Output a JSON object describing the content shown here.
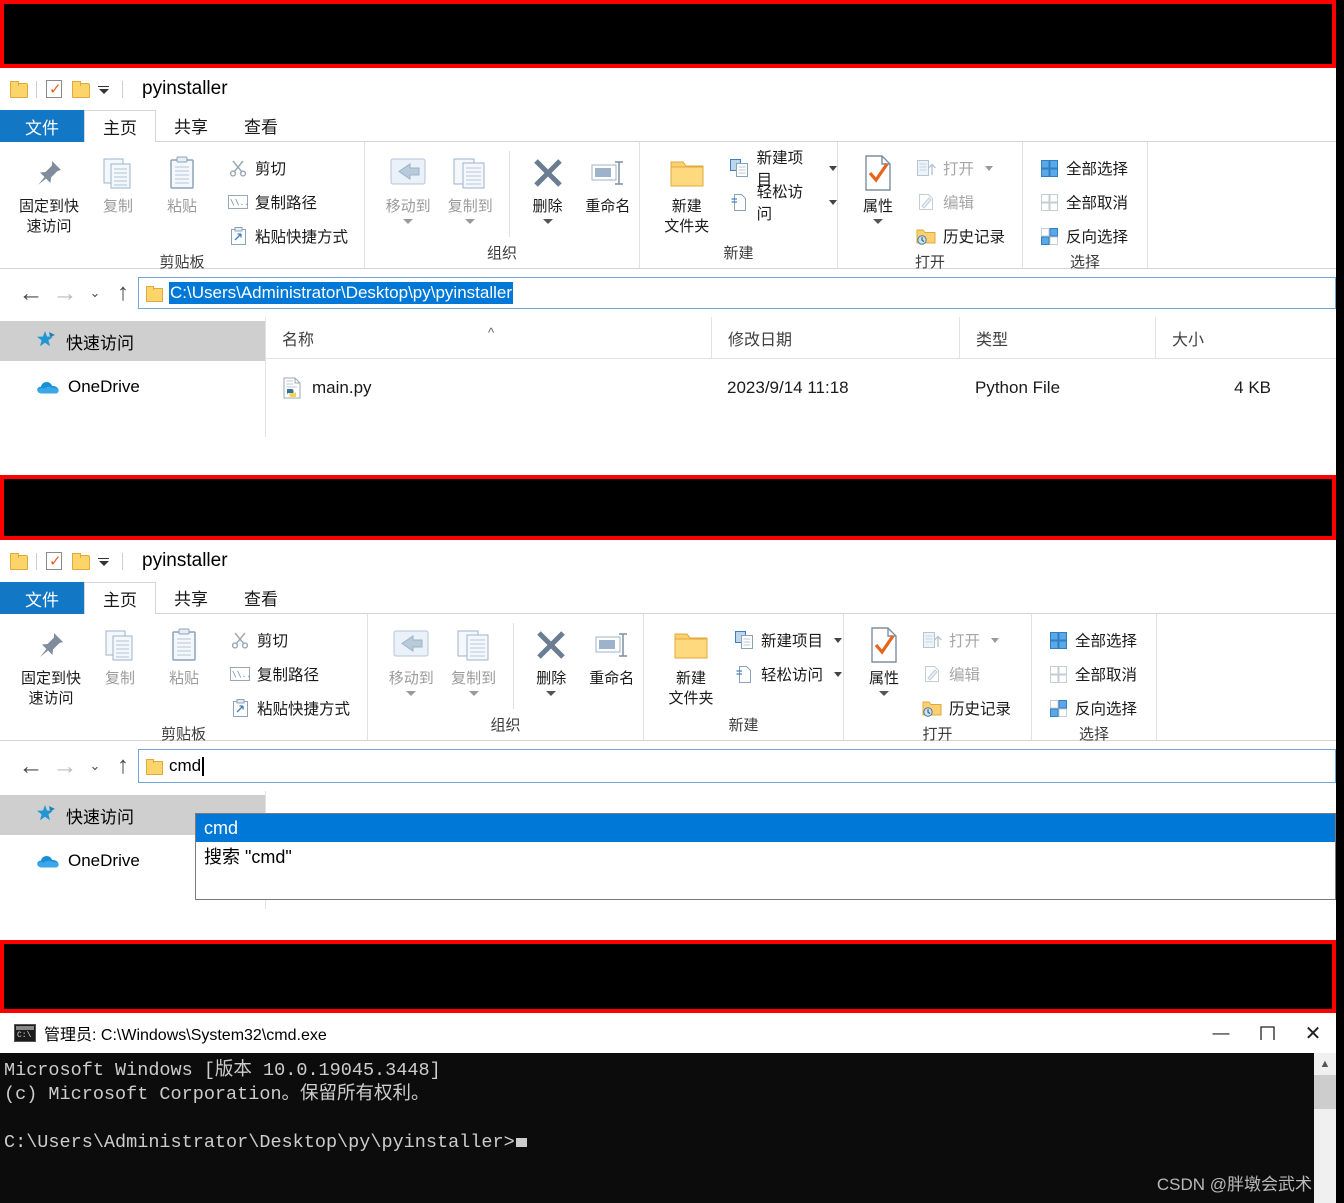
{
  "window": {
    "title": "pyinstaller",
    "quick_access_icons": [
      "folder-icon",
      "properties-check-icon",
      "folder-icon",
      "customize-dropdown-icon"
    ]
  },
  "tabs": [
    {
      "id": "file",
      "label": "文件"
    },
    {
      "id": "home",
      "label": "主页"
    },
    {
      "id": "share",
      "label": "共享"
    },
    {
      "id": "view",
      "label": "查看"
    }
  ],
  "ribbon": {
    "groups": [
      {
        "id": "clipboard",
        "label": "剪贴板",
        "big": [
          {
            "label1": "固定到快",
            "label2": "速访问",
            "icon": "pin-icon"
          },
          {
            "label1": "复制",
            "label2": "",
            "icon": "copy-icon"
          },
          {
            "label1": "粘贴",
            "label2": "",
            "icon": "paste-icon"
          }
        ],
        "small": [
          {
            "label": "剪切",
            "icon": "scissors-icon"
          },
          {
            "label": "复制路径",
            "icon": "copy-path-icon"
          },
          {
            "label": "粘贴快捷方式",
            "icon": "paste-shortcut-icon"
          }
        ]
      },
      {
        "id": "organize",
        "label": "组织",
        "big": [
          {
            "label1": "移动到",
            "label2": "",
            "icon": "move-to-icon",
            "caret": true
          },
          {
            "label1": "复制到",
            "label2": "",
            "icon": "copy-to-icon",
            "caret": true
          },
          {
            "label1": "删除",
            "label2": "",
            "icon": "delete-x-icon",
            "caret": true
          },
          {
            "label1": "重命名",
            "label2": "",
            "icon": "rename-icon"
          }
        ],
        "small": []
      },
      {
        "id": "new",
        "label": "新建",
        "big": [
          {
            "label1": "新建",
            "label2": "文件夹",
            "icon": "new-folder-icon"
          }
        ],
        "small": [
          {
            "label": "新建项目",
            "icon": "new-item-icon",
            "caret": true
          },
          {
            "label": "轻松访问",
            "icon": "easy-access-icon",
            "caret": true
          }
        ]
      },
      {
        "id": "open",
        "label": "打开",
        "big": [
          {
            "label1": "属性",
            "label2": "",
            "icon": "properties-icon",
            "caret": true
          }
        ],
        "small": [
          {
            "label": "打开",
            "icon": "open-icon",
            "caret": true,
            "dim": true
          },
          {
            "label": "编辑",
            "icon": "edit-icon",
            "dim": true
          },
          {
            "label": "历史记录",
            "icon": "history-icon"
          }
        ]
      },
      {
        "id": "select",
        "label": "选择",
        "big": [],
        "small": [
          {
            "label": "全部选择",
            "icon": "select-all-icon"
          },
          {
            "label": "全部取消",
            "icon": "select-none-icon"
          },
          {
            "label": "反向选择",
            "icon": "invert-selection-icon"
          }
        ]
      }
    ]
  },
  "nav": {
    "back_icon": "arrow-left-icon",
    "forward_icon": "arrow-right-icon",
    "recent_icon": "chevron-down-icon",
    "up_icon": "arrow-up-icon"
  },
  "address_top": {
    "value": "C:\\Users\\Administrator\\Desktop\\py\\pyinstaller",
    "selected": true
  },
  "address_bottom": {
    "value": "cmd",
    "suggestions": [
      {
        "label": "cmd",
        "selected": true
      },
      {
        "label": "搜索 \"cmd\"",
        "selected": false
      }
    ]
  },
  "sidebar": {
    "items": [
      {
        "label": "快速访问",
        "icon": "star-pin-icon",
        "selected": true
      },
      {
        "label": "OneDrive",
        "icon": "onedrive-cloud-icon",
        "selected": false
      }
    ]
  },
  "filelist": {
    "columns": [
      "名称",
      "修改日期",
      "类型",
      "大小"
    ],
    "sort_indicator": "^",
    "rows": [
      {
        "name": "main.py",
        "date": "2023/9/14 11:18",
        "type": "Python File",
        "size": "4 KB",
        "icon": "python-file-icon"
      }
    ]
  },
  "cmd": {
    "title": "管理员: C:\\Windows\\System32\\cmd.exe",
    "icon": "console-icon",
    "buttons": {
      "minimize": "—",
      "maximize": "❐",
      "close": "✕"
    },
    "lines": [
      "Microsoft Windows [版本 10.0.19045.3448]",
      "(c) Microsoft Corporation。保留所有权利。",
      "",
      "C:\\Users\\Administrator\\Desktop\\py\\pyinstaller>"
    ]
  },
  "watermark": "CSDN @胖墩会武术",
  "colors": {
    "accent": "#0078d7",
    "file_tab": "#1277c4",
    "redaction_border": "#ff0000",
    "selection_gray": "#cfcfcf"
  }
}
